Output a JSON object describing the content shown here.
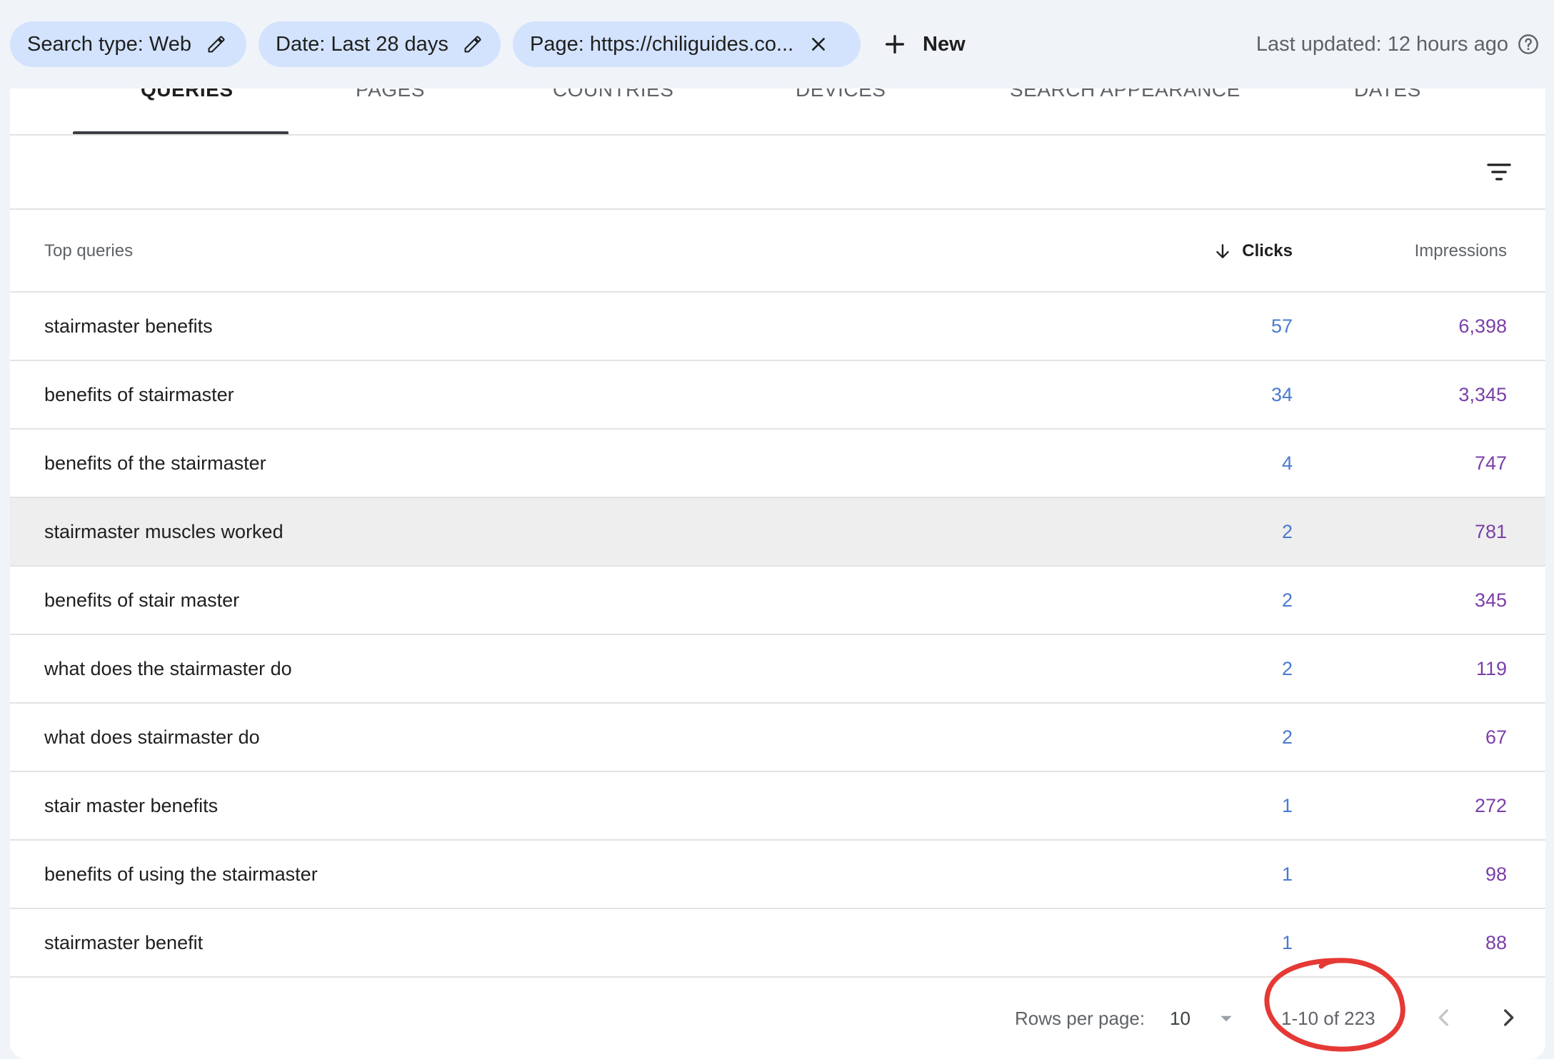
{
  "filters": {
    "search_type": "Search type: Web",
    "date": "Date: Last 28 days",
    "page": "Page: https://chiliguides.co..."
  },
  "new_label": "New",
  "last_updated": "Last updated: 12 hours ago",
  "tabs": [
    {
      "label": "QUERIES",
      "active": true
    },
    {
      "label": "PAGES"
    },
    {
      "label": "COUNTRIES"
    },
    {
      "label": "DEVICES"
    },
    {
      "label": "SEARCH APPEARANCE"
    },
    {
      "label": "DATES"
    }
  ],
  "table": {
    "headers": {
      "query": "Top queries",
      "clicks": "Clicks",
      "impressions": "Impressions"
    },
    "sorted_by": "Clicks",
    "rows": [
      {
        "query": "stairmaster benefits",
        "clicks": "57",
        "impressions": "6,398"
      },
      {
        "query": "benefits of stairmaster",
        "clicks": "34",
        "impressions": "3,345"
      },
      {
        "query": "benefits of the stairmaster",
        "clicks": "4",
        "impressions": "747"
      },
      {
        "query": "stairmaster muscles worked",
        "clicks": "2",
        "impressions": "781"
      },
      {
        "query": "benefits of stair master",
        "clicks": "2",
        "impressions": "345"
      },
      {
        "query": "what does the stairmaster do",
        "clicks": "2",
        "impressions": "119"
      },
      {
        "query": "what does stairmaster do",
        "clicks": "2",
        "impressions": "67"
      },
      {
        "query": "stair master benefits",
        "clicks": "1",
        "impressions": "272"
      },
      {
        "query": "benefits of using the stairmaster",
        "clicks": "1",
        "impressions": "98"
      },
      {
        "query": "stairmaster benefit",
        "clicks": "1",
        "impressions": "88"
      }
    ]
  },
  "pagination": {
    "rows_per_page_label": "Rows per page:",
    "rows_per_page_value": "10",
    "range": "1-10 of 223"
  },
  "icons": {
    "edit": "pencil-icon",
    "close": "close-icon",
    "add": "plus-icon",
    "help": "help-circle-icon",
    "filter": "filter-icon",
    "sort": "arrow-down-icon",
    "dropdown": "caret-down-icon",
    "prev": "chevron-left-icon",
    "next": "chevron-right-icon"
  },
  "colors": {
    "chip_bg": "#d3e3fd",
    "clicks_text": "#4a7ad0",
    "impressions_text": "#7b3fa8",
    "annotation": "#e53935",
    "hover_row": "#eeeeee"
  }
}
